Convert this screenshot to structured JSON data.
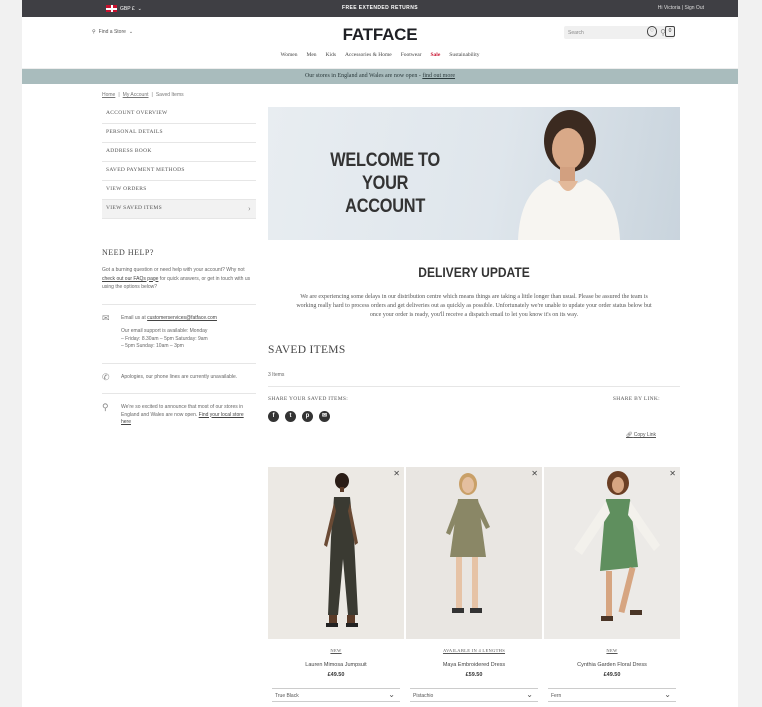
{
  "topbar": {
    "currency": "GBP £",
    "promo": "FREE EXTENDED RETURNS",
    "account": "Hi Victoria | Sign Out"
  },
  "header": {
    "store_label": "Find a Store",
    "logo": "FATFACE",
    "search_placeholder": "Search"
  },
  "nav": [
    "Women",
    "Men",
    "Kids",
    "Accessories & Home",
    "Footwear",
    "Sale",
    "Sustainability"
  ],
  "notice": {
    "text": "Our stores in England and Wales are now open - ",
    "link": "find out more"
  },
  "breadcrumb": [
    "Home",
    "My Account",
    "Saved Items"
  ],
  "sidebar": {
    "menu": [
      "ACCOUNT OVERVIEW",
      "PERSONAL DETAILS",
      "ADDRESS BOOK",
      "SAVED PAYMENT METHODS",
      "VIEW ORDERS",
      "VIEW SAVED ITEMS"
    ],
    "help_title": "NEED HELP?",
    "help_text_1": "Got a burning question or need help with your account? Why not ",
    "help_link": "check out our FAQs page",
    "help_text_2": " for quick answers, or get in touch with us using the options below?",
    "email_prefix": "Email us at ",
    "email_link": "customerservices@fatface.com",
    "email_hours": "Our email support is available: Monday – Friday: 8.30am – 5pm Saturday: 9am – 5pm Sunday: 10am – 3pm",
    "phone_text": "Apologies, our phone lines are currently unavailable.",
    "stores_text": "We're so excited to announce that most of our stores in England and Wales are now open. ",
    "stores_link": "Find your local store here"
  },
  "hero": {
    "title_line1": "WELCOME TO YOUR",
    "title_line2": "ACCOUNT"
  },
  "delivery": {
    "title": "DELIVERY UPDATE",
    "text": "We are experiencing some delays in our distribution centre which means things are taking a little longer than usual. Please be assured the team is working really hard to process orders and get deliveries out as quickly as possible. Unfortunately we're unable to update your order status below but once your order is ready, you'll receive a dispatch email to let you know it's on its way."
  },
  "saved": {
    "title": "SAVED ITEMS",
    "count": "3 Items",
    "share_label": "SHARE YOUR SAVED ITEMS:",
    "share_link_label": "SHARE BY LINK:",
    "copy_link": "Copy Link"
  },
  "products": [
    {
      "tag": "NEW",
      "name": "Lauren Mimosa Jumpsuit",
      "price": "£49.50",
      "select": "True Black",
      "bg": "#ece9e4",
      "dress": "#3a3a32"
    },
    {
      "tag": "AVAILABLE IN 4 LENGTHS",
      "name": "Maya Embroidered Dress",
      "price": "£59.50",
      "select": "Pistachio",
      "bg": "#e9e6e2",
      "dress": "#8a8766"
    },
    {
      "tag": "NEW",
      "name": "Cynthia Garden Floral Dress",
      "price": "£49.50",
      "select": "Fern",
      "bg": "#eceae7",
      "dress": "#5f8f5e"
    }
  ]
}
